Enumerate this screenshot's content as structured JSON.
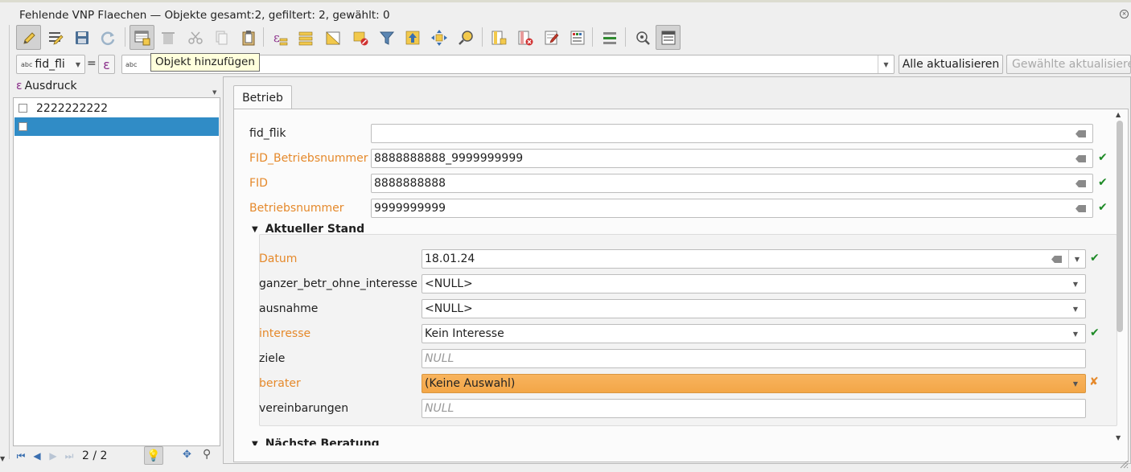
{
  "window": {
    "title": "Fehlende VNP Flaechen — Objekte gesamt:2, gefiltert: 2, gewählt: 0"
  },
  "toolbar": {
    "buttons": [
      {
        "icon": "pencil-edit-icon",
        "label": "Bearbeitungsmodus umschalten",
        "active": true
      },
      {
        "icon": "multi-edit-icon",
        "label": "Mehrfachbearbeitung"
      },
      {
        "icon": "save-icon",
        "label": "Bearbeitungen speichern"
      },
      {
        "icon": "reload-icon",
        "label": "Neu laden"
      },
      {
        "icon": "add-feature-icon",
        "label": "Objekt hinzufügen"
      },
      {
        "icon": "delete-icon",
        "label": "Gewählte Objekte löschen"
      },
      {
        "icon": "cut-icon",
        "label": "Ausschneiden"
      },
      {
        "icon": "copy-icon",
        "label": "Kopieren"
      },
      {
        "icon": "paste-icon",
        "label": "Einfügen"
      },
      {
        "icon": "select-expression-icon",
        "label": "Objekte mit Ausdruck wählen"
      },
      {
        "icon": "select-all-icon",
        "label": "Alles wählen"
      },
      {
        "icon": "invert-selection-icon",
        "label": "Auswahl umkehren"
      },
      {
        "icon": "deselect-icon",
        "label": "Auswahl aufheben"
      },
      {
        "icon": "filter-icon",
        "label": "Objekte filtern"
      },
      {
        "icon": "move-to-top-icon",
        "label": "Auswahl nach oben"
      },
      {
        "icon": "pan-to-selection-icon",
        "label": "Karte zur Auswahl verschieben"
      },
      {
        "icon": "zoom-to-selection-icon",
        "label": "Karte auf Auswahl zoomen"
      },
      {
        "icon": "new-field-icon",
        "label": "Neues Feld"
      },
      {
        "icon": "delete-field-icon",
        "label": "Feld löschen"
      },
      {
        "icon": "field-calculator-icon",
        "label": "Feldrechner"
      },
      {
        "icon": "conditional-formatting-icon",
        "label": "Bedingte Formatierung"
      },
      {
        "icon": "actions-icon",
        "label": "Aktionen"
      },
      {
        "icon": "dock-icon",
        "label": "Attributtabelle andocken"
      },
      {
        "icon": "form-view-icon",
        "label": "Formularansicht",
        "active": true
      }
    ],
    "tooltip": "Objekt hinzufügen"
  },
  "filterbar": {
    "field_type": "abc",
    "field_value": "fid_fli",
    "equals": "=",
    "expression_symbol": "ε",
    "input_type": "abc",
    "input_value": "",
    "update_all": "Alle aktualisieren",
    "update_selected": "Gewählte aktualisieren"
  },
  "left": {
    "header": "Ausdruck",
    "header_symbol": "ε",
    "items": [
      {
        "label": "2222222222",
        "selected": false
      },
      {
        "label": "",
        "selected": true
      }
    ],
    "nav": {
      "position": "2 / 2"
    }
  },
  "form": {
    "tab": "Betrieb",
    "fields": [
      {
        "label": "fid_flik",
        "value": "",
        "required": false,
        "valid": false
      },
      {
        "label": "FID_Betriebsnummer",
        "value": "8888888888_9999999999",
        "required": true,
        "valid": true
      },
      {
        "label": "FID",
        "value": "8888888888",
        "required": true,
        "valid": true
      },
      {
        "label": "Betriebsnummer",
        "value": "9999999999",
        "required": true,
        "valid": true
      }
    ],
    "group1": {
      "title": "Aktueller Stand",
      "datum": {
        "label": "Datum",
        "value": "18.01.24"
      },
      "ganzer": {
        "label": "ganzer_betr_ohne_interesse",
        "value": "<NULL>"
      },
      "ausnahme": {
        "label": "ausnahme",
        "value": "<NULL>"
      },
      "interesse": {
        "label": "interesse",
        "value": "Kein Interesse"
      },
      "ziele": {
        "label": "ziele",
        "value": "NULL"
      },
      "berater": {
        "label": "berater",
        "value": "(Keine Auswahl)"
      },
      "vereinbarungen": {
        "label": "vereinbarungen",
        "value": "NULL"
      }
    },
    "group2": {
      "title": "Nächste Beratung"
    }
  },
  "colors": {
    "accent": "#308cc6",
    "required_label": "#e5892b",
    "valid_check": "#1d8a26",
    "invalid_field": "#f3a647"
  }
}
